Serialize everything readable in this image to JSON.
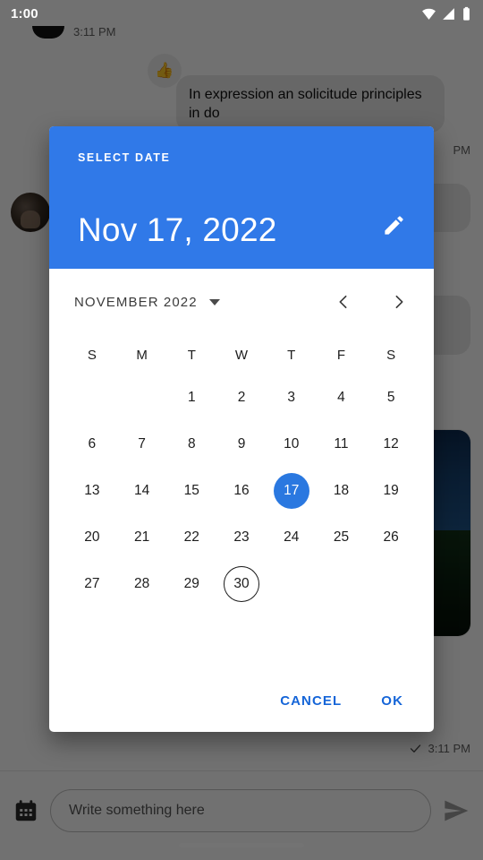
{
  "status_bar": {
    "clock": "1:00",
    "icons": [
      "wifi-icon",
      "cellular-signal-icon",
      "battery-icon"
    ]
  },
  "chat": {
    "timestamp_top": "3:11 PM",
    "timestamp_right": "PM",
    "timestamp_bottom": "3:11 PM",
    "incoming_message": "In expression an solicitude principles in do",
    "reaction_emoji": "👍"
  },
  "composer": {
    "calendar_icon": "calendar-icon",
    "placeholder": "Write something here",
    "send_icon": "send-icon"
  },
  "dialog": {
    "overline": "SELECT DATE",
    "selected_date_label": "Nov 17, 2022",
    "edit_icon": "pencil-icon",
    "month_label": "NOVEMBER 2022",
    "dropdown_icon": "caret-down-icon",
    "prev_icon": "chevron-left-icon",
    "next_icon": "chevron-right-icon",
    "weekdays": [
      "S",
      "M",
      "T",
      "W",
      "T",
      "F",
      "S"
    ],
    "weeks": [
      [
        "",
        "",
        "1",
        "2",
        "3",
        "4",
        "5"
      ],
      [
        "6",
        "7",
        "8",
        "9",
        "10",
        "11",
        "12"
      ],
      [
        "13",
        "14",
        "15",
        "16",
        "17",
        "18",
        "19"
      ],
      [
        "20",
        "21",
        "22",
        "23",
        "24",
        "25",
        "26"
      ],
      [
        "27",
        "28",
        "29",
        "30",
        "",
        "",
        ""
      ]
    ],
    "selected_day": "17",
    "today_day": "30",
    "cancel_label": "CANCEL",
    "ok_label": "OK"
  },
  "colors": {
    "accent_blue": "#3079e8",
    "selected_blue": "#2a78e0",
    "action_blue": "#1565d8",
    "scrim": "rgba(0,0,0,0.55)"
  }
}
